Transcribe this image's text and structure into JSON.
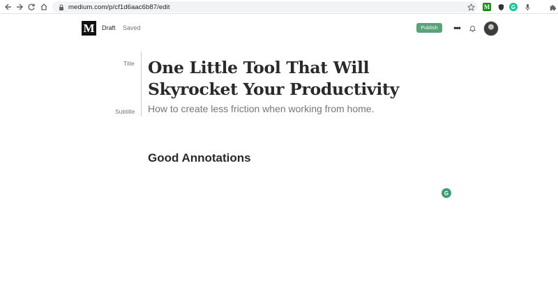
{
  "browser": {
    "url": "medium.com/p/cf1d6aac6b87/edit",
    "icons": [
      "back-arrow-icon",
      "forward-arrow-icon",
      "reload-icon",
      "home-icon",
      "lock-icon",
      "star-icon",
      "medium-extension-icon",
      "shield-extension-icon",
      "grammarly-extension-icon",
      "microphone-icon",
      "puzzle-extensions-icon"
    ]
  },
  "header": {
    "logo_letter": "M",
    "status": "Draft",
    "save_state": "Saved",
    "publish_label": "Publish",
    "more_label": "•••",
    "accent_color": "#59a27a"
  },
  "editor": {
    "title_label": "Title",
    "subtitle_label": "Subtitle",
    "title": "One Little Tool That Will Skyrocket Your Productivity",
    "subtitle": "How to create less friction when working from home.",
    "heading": "Good Annotations"
  },
  "grammarly": {
    "badge_letter": "G"
  }
}
